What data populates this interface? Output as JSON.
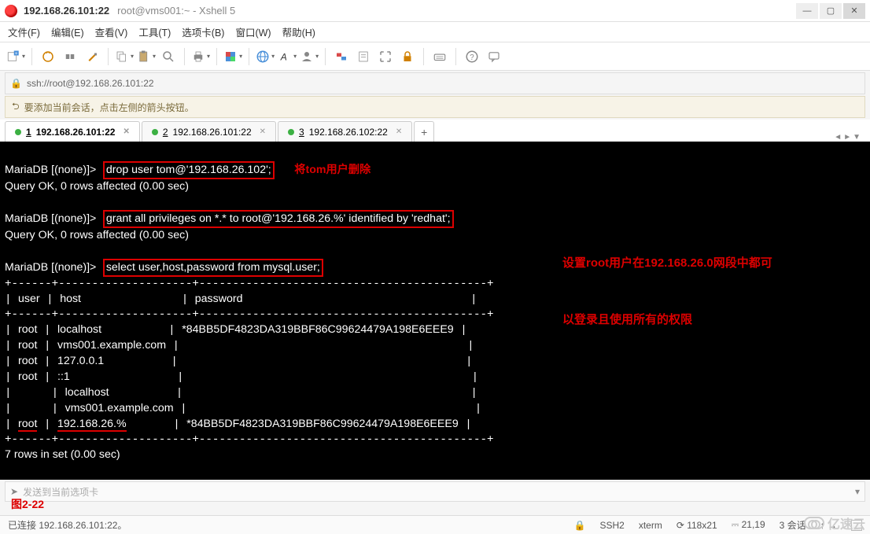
{
  "title": {
    "ip": "192.168.26.101:22",
    "sub": "root@vms001:~ - Xshell 5"
  },
  "menu": {
    "file": "文件(F)",
    "edit": "编辑(E)",
    "view": "查看(V)",
    "tools": "工具(T)",
    "tab": "选项卡(B)",
    "window": "窗口(W)",
    "help": "帮助(H)"
  },
  "address": "ssh://root@192.168.26.101:22",
  "hint": "要添加当前会话，点击左侧的箭头按钮。",
  "tabs": [
    {
      "num": "1",
      "label": "192.168.26.101:22",
      "active": true
    },
    {
      "num": "2",
      "label": "192.168.26.101:22",
      "active": false
    },
    {
      "num": "3",
      "label": "192.168.26.102:22",
      "active": false
    }
  ],
  "annotations": {
    "drop_user": "将tom用户删除",
    "grant_note_l1": "设置root用户在192.168.26.0网段中都可",
    "grant_note_l2": "以登录且使用所有的权限",
    "figure": "图2-22"
  },
  "sql": {
    "prompt": "MariaDB [(none)]>",
    "cmd1": "drop user tom@'192.168.26.102';",
    "resp1": "Query OK, 0 rows affected (0.00 sec)",
    "cmd2": "grant all privileges on *.* to root@'192.168.26.%' identified by 'redhat';",
    "resp2": "Query OK, 0 rows affected (0.00 sec)",
    "cmd3": "select user,host,password from mysql.user;",
    "hdr_user": "user",
    "hdr_host": "host",
    "hdr_pass": "password",
    "rows": [
      {
        "user": "root",
        "host": "localhost",
        "pass": "*84BB5DF4823DA319BBF86C99624479A198E6EEE9"
      },
      {
        "user": "root",
        "host": "vms001.example.com",
        "pass": ""
      },
      {
        "user": "root",
        "host": "127.0.0.1",
        "pass": ""
      },
      {
        "user": "root",
        "host": "::1",
        "pass": ""
      },
      {
        "user": "",
        "host": "localhost",
        "pass": ""
      },
      {
        "user": "",
        "host": "vms001.example.com",
        "pass": ""
      },
      {
        "user": "root",
        "host": "192.168.26.%",
        "pass": "*84BB5DF4823DA319BBF86C99624479A198E6EEE9"
      }
    ],
    "tail": "7 rows in set (0.00 sec)"
  },
  "inputbar": "发送到当前选项卡",
  "status": {
    "conn": "已连接 192.168.26.101:22。",
    "proto": "SSH2",
    "term": "xterm",
    "size": "118x21",
    "pos": "21,19",
    "sess": "3 会话",
    "arrows": "↑  ↔"
  },
  "watermark": "亿速云"
}
